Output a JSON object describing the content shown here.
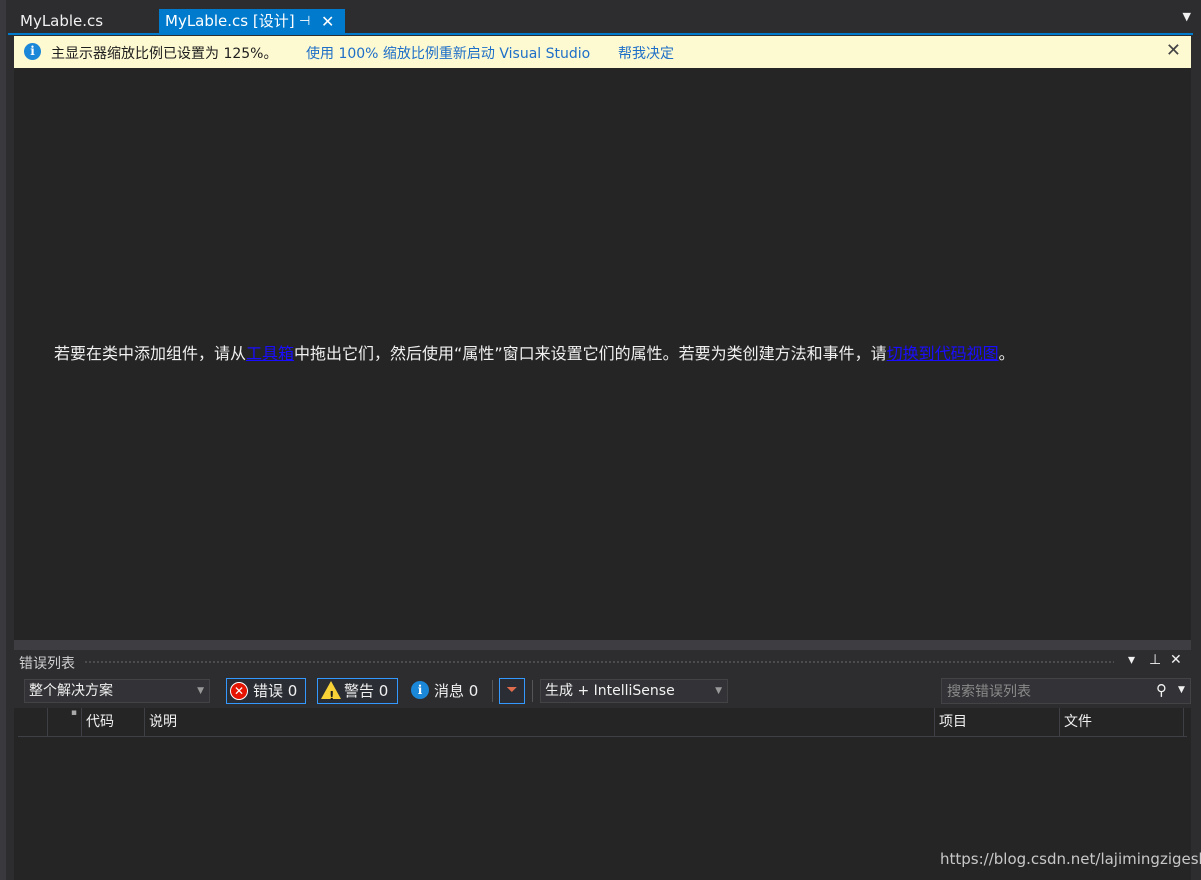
{
  "tabs": {
    "inactive_label": "MyLable.cs",
    "active_label": "MyLable.cs [设计]",
    "pin_glyph": "⊣",
    "close_glyph": "✕",
    "dropdown_glyph": "▼"
  },
  "infobar": {
    "message": "主显示器缩放比例已设置为 125%。",
    "restart_link": "使用 100% 缩放比例重新启动 Visual Studio",
    "decide_link": "帮我决定",
    "close_glyph": "✕"
  },
  "designer": {
    "hint_part1": "若要在类中添加组件，请从",
    "toolbox_link": "工具箱",
    "hint_part2": "中拖出它们，然后使用“属性”窗口来设置它们的属性。若要为类创建方法和事件，请",
    "code_view_link": "切换到代码视图",
    "hint_end": "。"
  },
  "error_list": {
    "title": "错误列表",
    "title_controls": [
      "▾",
      "⊥",
      "✕"
    ],
    "scope_selected": "整个解决方案",
    "errors_label": "错误 0",
    "warnings_label": "警告 0",
    "messages_label": "消息 0",
    "source_selected": "生成 + IntelliSense",
    "search_placeholder": "搜索错误列表",
    "columns": {
      "code": "代码",
      "description": "说明",
      "project": "项目",
      "file": "文件"
    }
  },
  "watermark": "https://blog.csdn.net/lajimingzigeshi",
  "colors": {
    "accent": "#007acc",
    "infobar_bg": "#fdf9d1",
    "link_blue": "#1a0dff",
    "error_red": "#e51400",
    "warning_yellow": "#f9d237"
  }
}
